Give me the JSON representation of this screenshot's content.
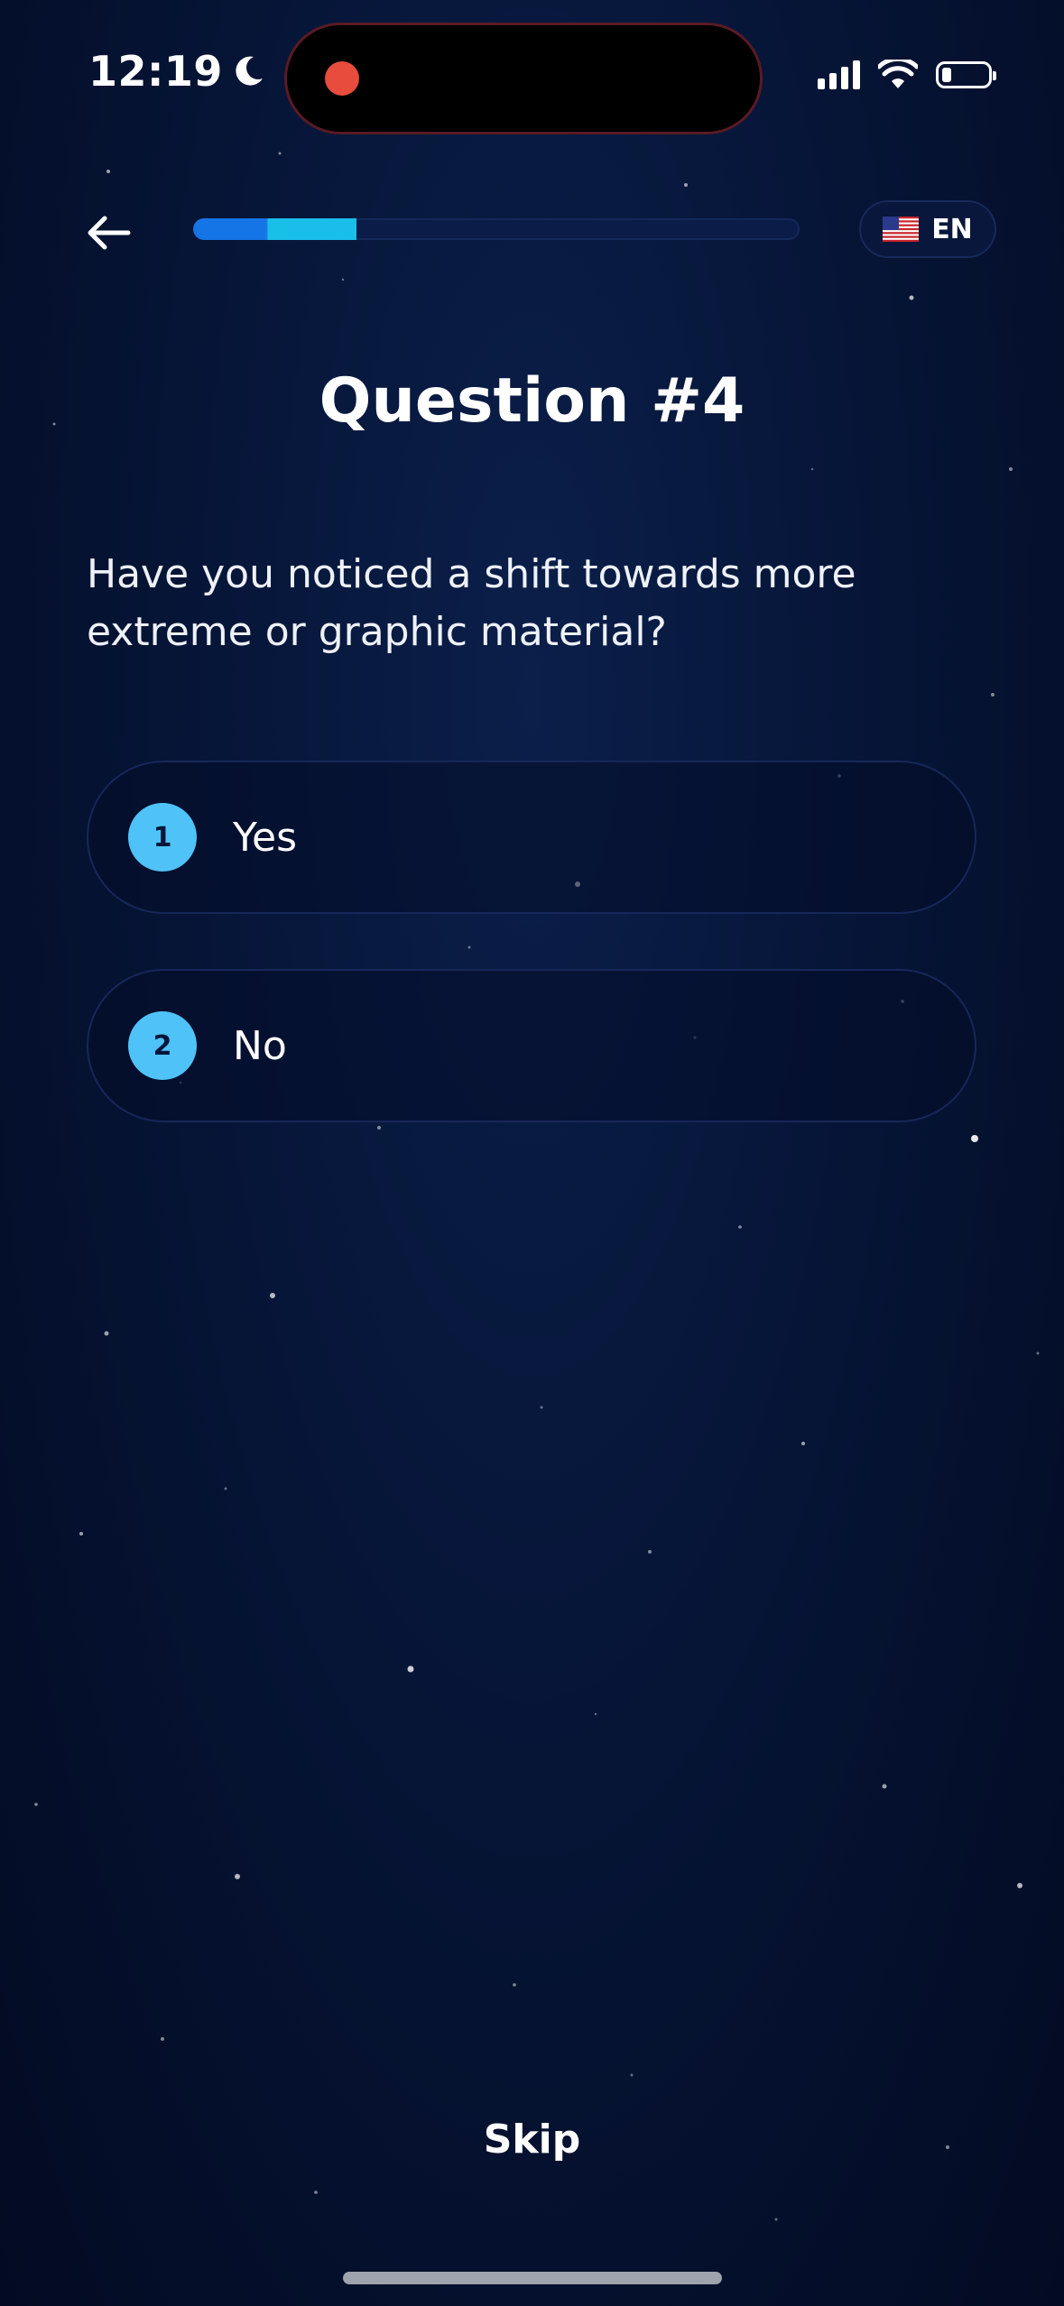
{
  "status_bar": {
    "time": "12:19",
    "moon_icon": "moon-icon",
    "recording_indicator_color": "#e74c3c",
    "signal_icon": "signal-bars-icon",
    "wifi_icon": "wifi-icon",
    "battery_icon": "battery-icon",
    "battery_level": 0.2
  },
  "header": {
    "back_icon": "arrow-left-icon",
    "progress": 0.27,
    "language": {
      "flag_icon": "us-flag-icon",
      "code": "EN"
    }
  },
  "quiz": {
    "title": "Question #4",
    "question": "Have you noticed a shift towards more extreme or graphic material?",
    "options": [
      {
        "number": "1",
        "label": "Yes"
      },
      {
        "number": "2",
        "label": "No"
      }
    ]
  },
  "footer": {
    "skip_label": "Skip"
  },
  "colors": {
    "background": "#061537",
    "accent": "#4fc3f7",
    "progress_primary": "#1675e6",
    "progress_secondary": "#19bfe8"
  }
}
